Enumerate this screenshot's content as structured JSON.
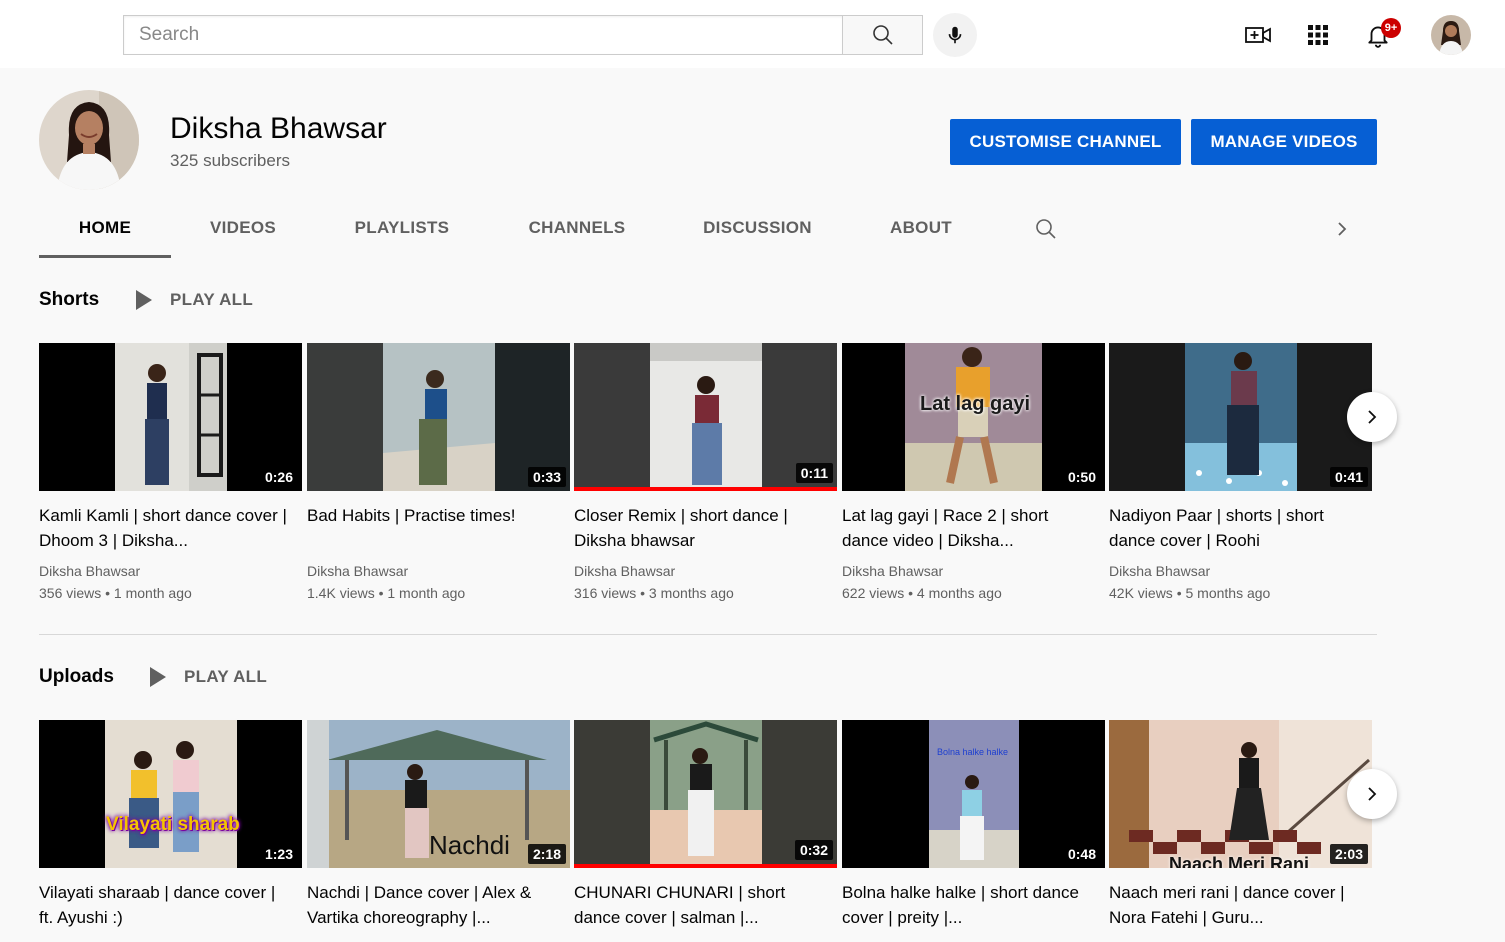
{
  "search": {
    "placeholder": "Search"
  },
  "topbar": {
    "create_icon": "video-plus-icon",
    "apps_icon": "apps-grid-icon",
    "notifications_icon": "bell-icon",
    "notification_badge": "9+"
  },
  "channel": {
    "name": "Diksha Bhawsar",
    "subscribers": "325 subscribers",
    "customise_label": "CUSTOMISE CHANNEL",
    "manage_label": "MANAGE VIDEOS"
  },
  "tabs": [
    {
      "label": "HOME",
      "active": true
    },
    {
      "label": "VIDEOS"
    },
    {
      "label": "PLAYLISTS"
    },
    {
      "label": "CHANNELS"
    },
    {
      "label": "DISCUSSION"
    },
    {
      "label": "ABOUT"
    }
  ],
  "shorts": {
    "title": "Shorts",
    "play_all": "PLAY ALL",
    "videos": [
      {
        "title": "Kamli Kamli | short dance cover | Dhoom 3 | Diksha...",
        "channel": "Diksha Bhawsar",
        "meta": "356 views • 1 month ago",
        "duration": "0:26"
      },
      {
        "title": "Bad Habits | Practise times!",
        "channel": "Diksha Bhawsar",
        "meta": "1.4K views • 1 month ago",
        "duration": "0:33"
      },
      {
        "title": "Closer Remix | short dance | Diksha bhawsar",
        "channel": "Diksha Bhawsar",
        "meta": "316 views • 3 months ago",
        "duration": "0:11",
        "watched": 1.0
      },
      {
        "title": "Lat lag gayi | Race 2 | short dance video | Diksha...",
        "channel": "Diksha Bhawsar",
        "meta": "622 views • 4 months ago",
        "duration": "0:50",
        "overlay": "Lat lag gayi"
      },
      {
        "title": "Nadiyon Paar | shorts | short dance cover | Roohi",
        "channel": "Diksha Bhawsar",
        "meta": "42K views • 5 months ago",
        "duration": "0:41"
      }
    ]
  },
  "uploads": {
    "title": "Uploads",
    "play_all": "PLAY ALL",
    "videos": [
      {
        "title": "Vilayati sharaab | dance cover | ft. Ayushi :)",
        "duration": "1:23",
        "overlay": "Vilayati sharab"
      },
      {
        "title": "Nachdi | Dance cover | Alex & Vartika choreography |...",
        "duration": "2:18",
        "overlay": "Nachdi"
      },
      {
        "title": "CHUNARI CHUNARI | short dance cover | salman |...",
        "duration": "0:32",
        "watched": 1.0
      },
      {
        "title": "Bolna halke halke | short dance cover | preity |...",
        "duration": "0:48",
        "overlay": "Bolna halke halke"
      },
      {
        "title": "Naach meri rani | dance cover | Nora Fatehi | Guru...",
        "duration": "2:03",
        "overlay": "Naach Meri Rani"
      }
    ]
  }
}
